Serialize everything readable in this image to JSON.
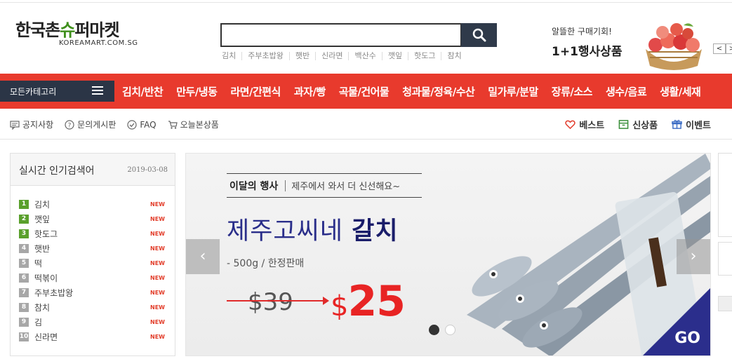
{
  "logo": {
    "main_a": "한국촌",
    "main_leaf": "슈",
    "main_b": "퍼마켓",
    "sub": "KOREAMART.COM.SG"
  },
  "search": {
    "value": "",
    "placeholder": ""
  },
  "popular_keywords": [
    "김치",
    "주부초밥왕",
    "햇반",
    "신라면",
    "백산수",
    "깻잎",
    "핫도그",
    "참치"
  ],
  "promo": {
    "small": "알뜰한 구매기회!",
    "big": "1+1행사상품",
    "prev": "<",
    "next": ">"
  },
  "nav": {
    "all_categories": "모든카테고리",
    "items": [
      "김치/반찬",
      "만두/냉동",
      "라면/간편식",
      "과자/빵",
      "곡물/건어물",
      "청과물/정육/수산",
      "밀가루/분말",
      "장류/소스",
      "생수/음료",
      "생활/세재"
    ]
  },
  "sublinks": [
    "공지사항",
    "문의게시판",
    "FAQ",
    "오늘본상품"
  ],
  "rightlinks": [
    "베스트",
    "신상품",
    "이벤트"
  ],
  "ranking": {
    "title": "실시간 인기검색어",
    "date": "2019-03-08",
    "new_label": "NEW",
    "items": [
      {
        "rank": "1",
        "name": "김치"
      },
      {
        "rank": "2",
        "name": "깻잎"
      },
      {
        "rank": "3",
        "name": "핫도그"
      },
      {
        "rank": "4",
        "name": "햇반"
      },
      {
        "rank": "5",
        "name": "떡"
      },
      {
        "rank": "6",
        "name": "떡볶이"
      },
      {
        "rank": "7",
        "name": "주부초밥왕"
      },
      {
        "rank": "8",
        "name": "참치"
      },
      {
        "rank": "9",
        "name": "김"
      },
      {
        "rank": "10",
        "name": "신라면"
      }
    ]
  },
  "banner": {
    "event_label": "이달의 행사",
    "event_desc": "제주에서 와서 더 신선해요~",
    "title_a": "제주고씨네",
    "title_b": "갈치",
    "sub": "- 500g / 한정판매",
    "old_price": "$39",
    "new_currency": "$",
    "new_price": "25",
    "go": "GO",
    "prev": "‹",
    "next": "›"
  },
  "colors": {
    "accent_red": "#e83a2d",
    "navy": "#2b3546",
    "green": "#5aa02c"
  }
}
